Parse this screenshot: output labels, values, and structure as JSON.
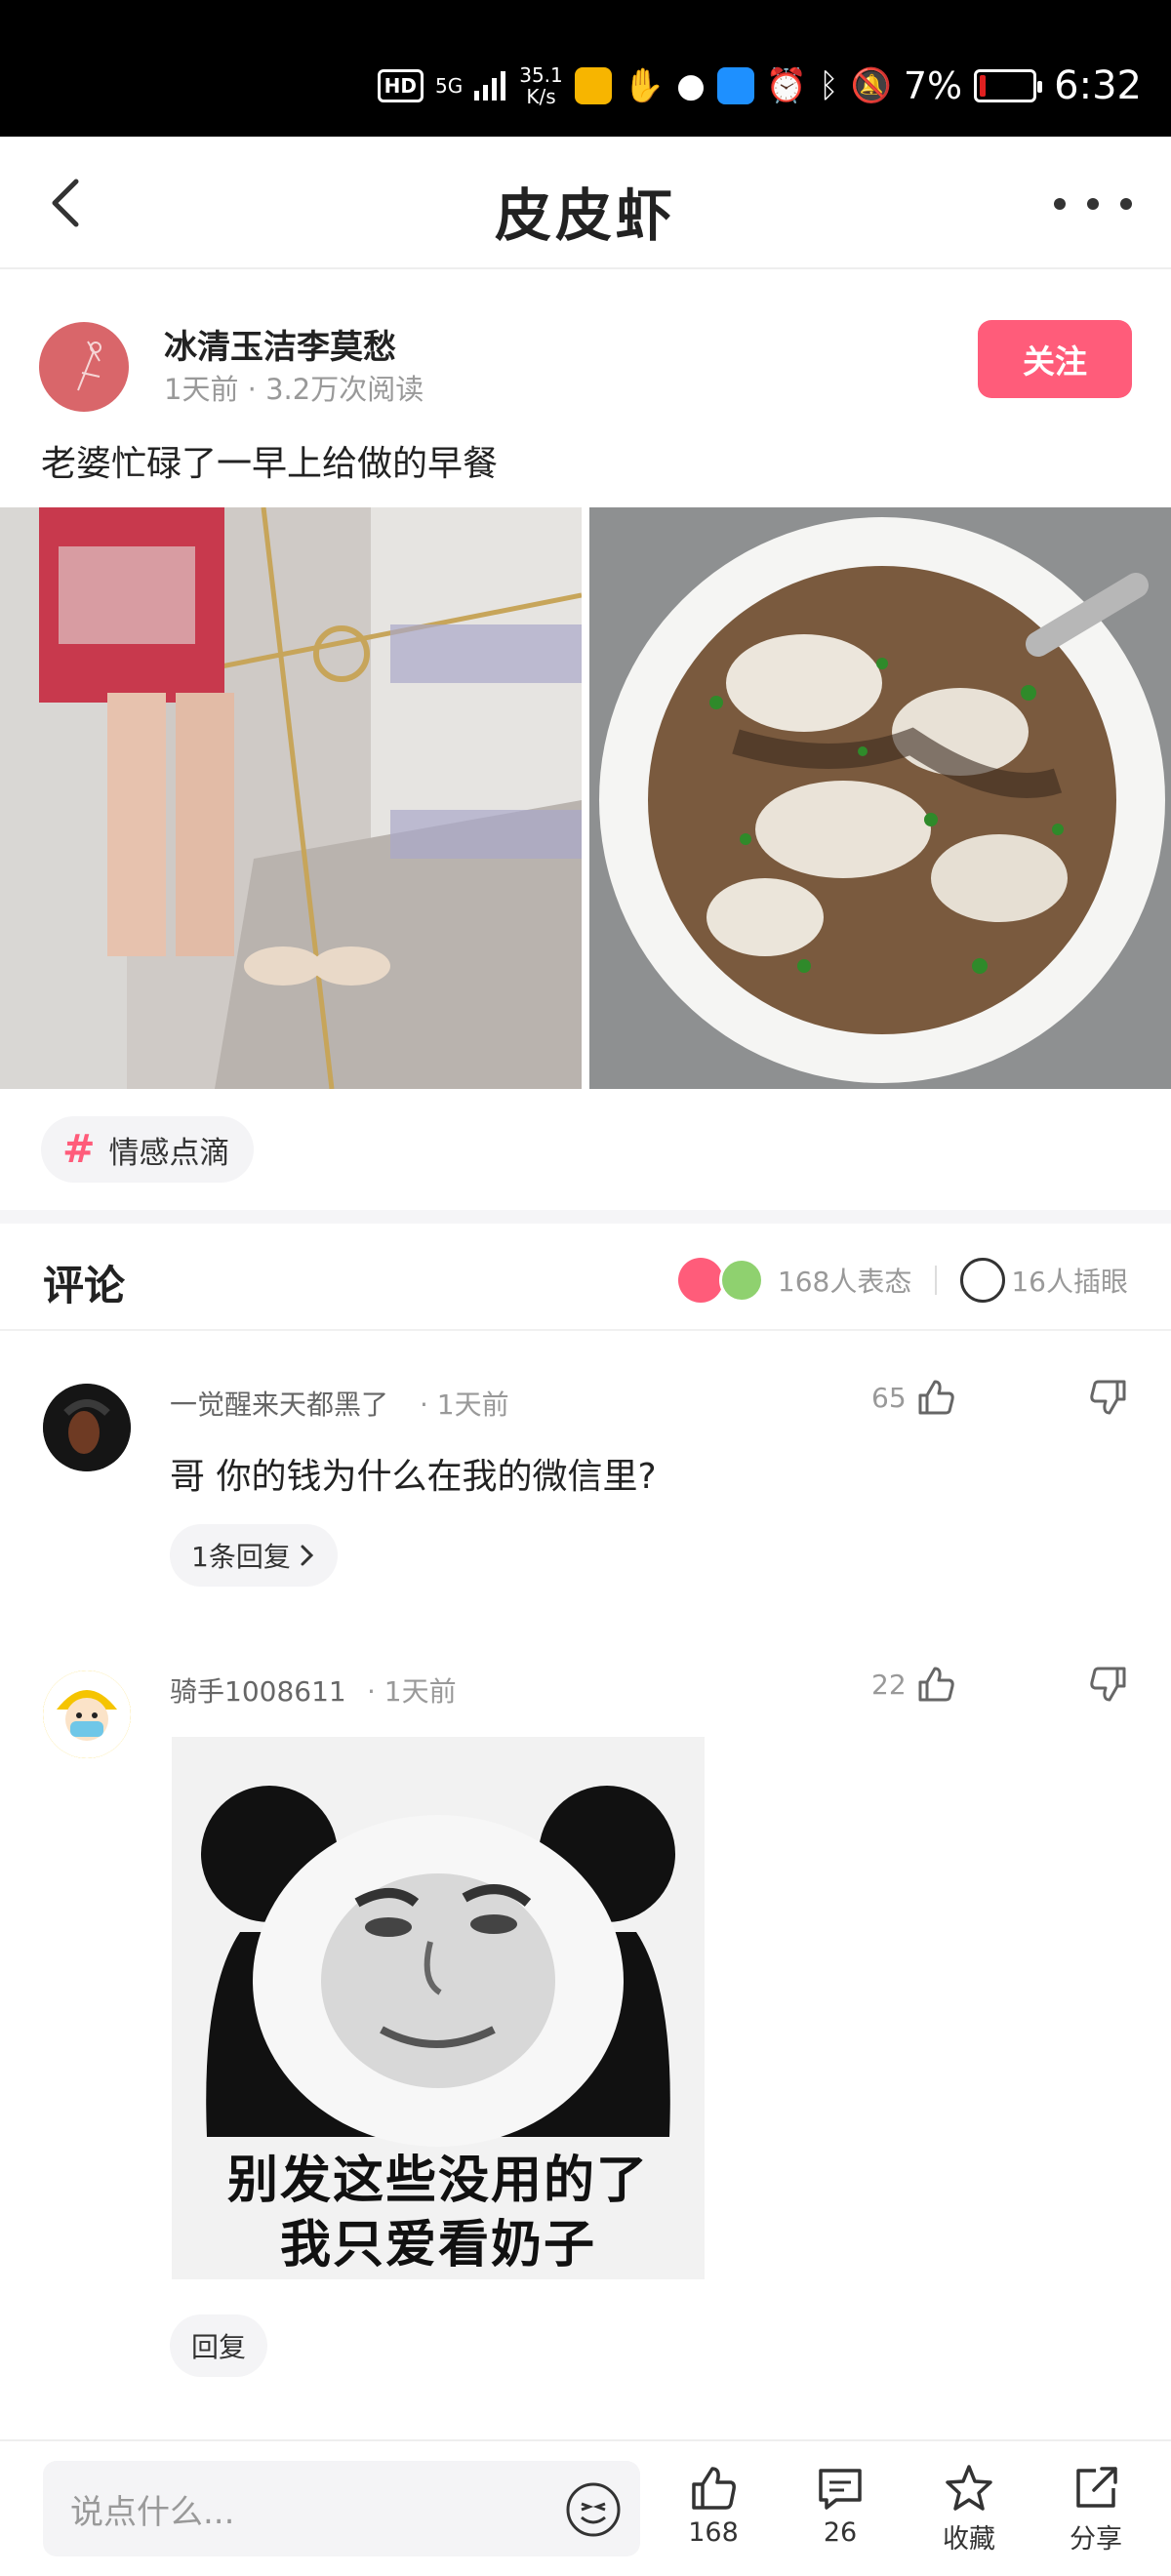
{
  "status_bar": {
    "hd": "HD",
    "network": "5G",
    "speed_top": "35.1",
    "speed_unit": "K/s",
    "battery_pct": "7%",
    "time": "6:32"
  },
  "nav": {
    "title": "皮皮虾"
  },
  "post": {
    "author": "冰清玉洁李莫愁",
    "meta": "1天前 · 3.2万次阅读",
    "follow_label": "关注",
    "text": "老婆忙碌了一早上给做的早餐",
    "tag": "情感点滴"
  },
  "comments_section": {
    "title": "评论",
    "reactions_count": "168人表态",
    "eye_count": "16人插眼"
  },
  "comments": [
    {
      "user": "一觉醒来天都黑了",
      "time": "· 1天前",
      "likes": "65",
      "text": "哥 你的钱为什么在我的微信里?",
      "reply_label": "1条回复"
    },
    {
      "user": "骑手1008611",
      "time": "· 1天前",
      "likes": "22",
      "meme_line1": "别发这些没用的了",
      "meme_line2": "我只爱看奶子",
      "reply_label": "回复"
    }
  ],
  "bottom_bar": {
    "input_placeholder": "说点什么...",
    "like_count": "168",
    "comment_count": "26",
    "collect_label": "收藏",
    "share_label": "分享"
  },
  "colors": {
    "accent": "#ff5c7a",
    "muted": "#999999"
  }
}
